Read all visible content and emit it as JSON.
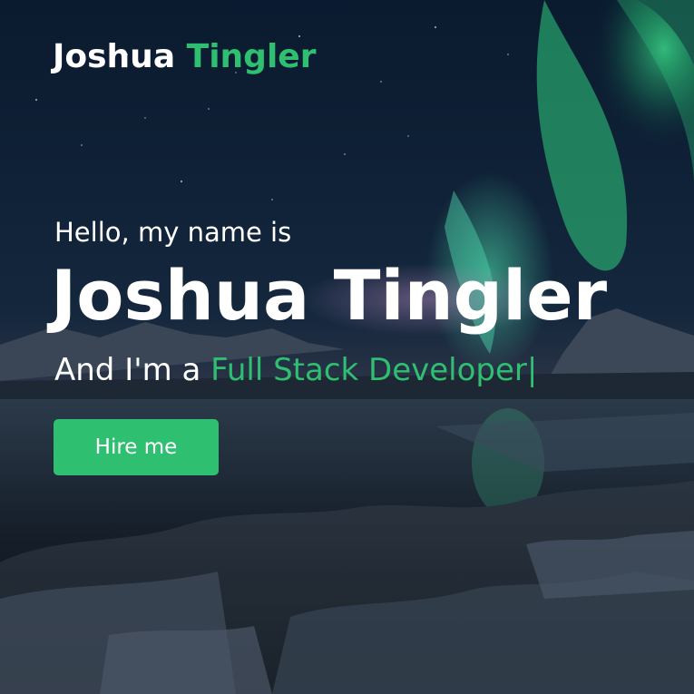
{
  "brand": {
    "first": "Joshua",
    "last": "Tingler"
  },
  "hero": {
    "greeting": "Hello, my name is",
    "name": "Joshua Tingler",
    "role_prefix": "And I'm a",
    "role": "Full Stack Developer",
    "cursor": "|",
    "cta_label": "Hire me"
  },
  "colors": {
    "accent": "#2fbf71",
    "text": "#ffffff",
    "sky": "#0b1a2e"
  },
  "background": {
    "scene": "aurora-night-sky-over-snowy-beach"
  }
}
